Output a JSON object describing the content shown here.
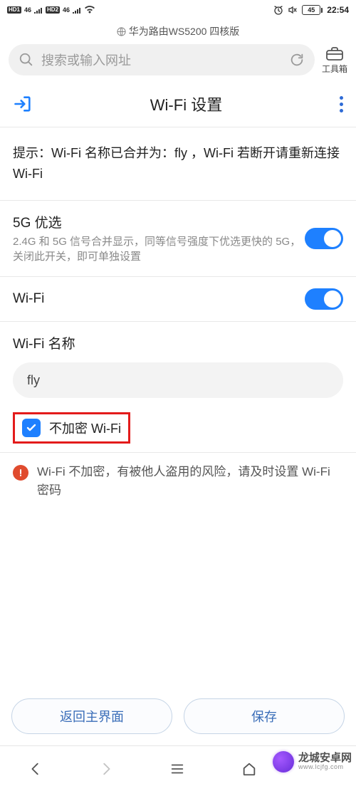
{
  "status_bar": {
    "hd1": "HD1",
    "hd2": "HD2",
    "sig1": "46",
    "sig2": "46",
    "battery": "45",
    "time": "22:54"
  },
  "browser": {
    "tab_title": "华为路由WS5200 四核版",
    "placeholder": "搜索或输入网址",
    "toolbox_label": "工具箱"
  },
  "page": {
    "title": "Wi-Fi 设置",
    "hint": "提示：Wi-Fi 名称已合并为：fly ，Wi-Fi 若断开请重新连接 Wi-Fi"
  },
  "settings": {
    "g5_title": "5G 优选",
    "g5_desc": "2.4G 和 5G 信号合并显示，同等信号强度下优选更快的 5G，关闭此开关，即可单独设置",
    "wifi_label": "Wi-Fi",
    "name_label": "Wi-Fi 名称",
    "name_value": "fly",
    "no_encrypt_label": "不加密 Wi-Fi",
    "warn_text": "Wi-Fi 不加密，有被他人盗用的风险，请及时设置 Wi-Fi 密码"
  },
  "buttons": {
    "back_label": "返回主界面",
    "save_label": "保存"
  },
  "watermark": {
    "title": "龙城安卓网",
    "sub": "www.lcjfg.com"
  }
}
